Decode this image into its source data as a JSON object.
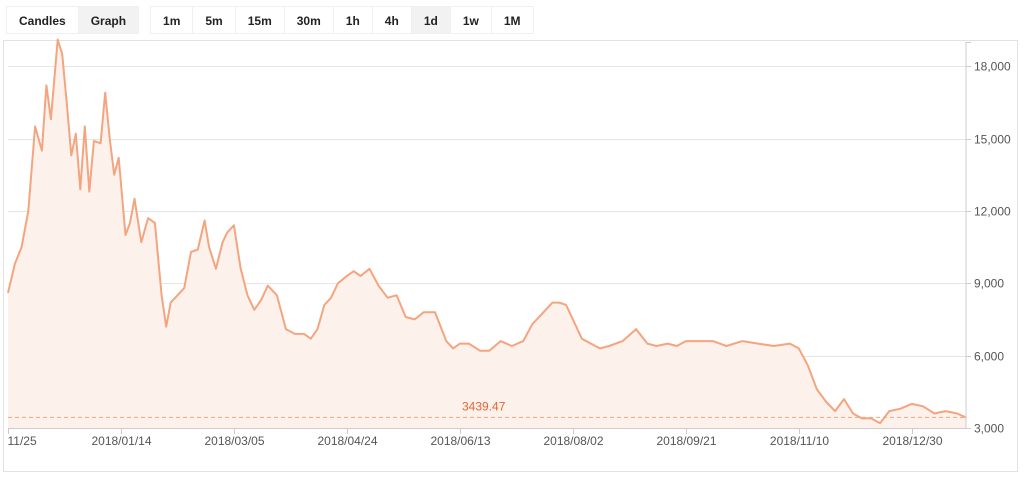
{
  "toolbar": {
    "chart_types": [
      "Candles",
      "Graph"
    ],
    "active_chart_type": "Graph",
    "intervals": [
      "1m",
      "5m",
      "15m",
      "30m",
      "1h",
      "4h",
      "1d",
      "1w",
      "1M"
    ],
    "active_interval": "1d"
  },
  "chart_data": {
    "type": "area",
    "title": "",
    "xlabel": "",
    "ylabel": "",
    "x_ticks": [
      "11/25",
      "2018/01/14",
      "2018/03/05",
      "2018/04/24",
      "2018/06/13",
      "2018/08/02",
      "2018/09/21",
      "2018/11/10",
      "2018/12/30"
    ],
    "y_ticks": [
      "3,000",
      "6,000",
      "9,000",
      "12,000",
      "15,000",
      "18,000"
    ],
    "ylim": [
      3000,
      19000
    ],
    "xlim": [
      "2017-11-25",
      "2019-01-23"
    ],
    "last_value_label": "3439.47",
    "last_value": 3439.47,
    "grid": true,
    "line_color": "#f4a57f",
    "fill_color": "#fdf1ec",
    "label_color": "#e8642f",
    "series": [
      {
        "x": [
          "2017-11-25",
          "2017-11-28",
          "2017-12-01",
          "2017-12-04",
          "2017-12-07",
          "2017-12-10",
          "2017-12-12",
          "2017-12-14",
          "2017-12-17",
          "2017-12-19",
          "2017-12-21",
          "2017-12-23",
          "2017-12-25",
          "2017-12-27",
          "2017-12-29",
          "2017-12-31",
          "2018-01-02",
          "2018-01-05",
          "2018-01-07",
          "2018-01-09",
          "2018-01-11",
          "2018-01-13",
          "2018-01-16",
          "2018-01-18",
          "2018-01-20",
          "2018-01-23",
          "2018-01-26",
          "2018-01-29",
          "2018-02-01",
          "2018-02-03",
          "2018-02-05",
          "2018-02-08",
          "2018-02-11",
          "2018-02-14",
          "2018-02-17",
          "2018-02-20",
          "2018-02-22",
          "2018-02-25",
          "2018-02-28",
          "2018-03-02",
          "2018-03-05",
          "2018-03-08",
          "2018-03-11",
          "2018-03-14",
          "2018-03-17",
          "2018-03-20",
          "2018-03-24",
          "2018-03-28",
          "2018-04-01",
          "2018-04-05",
          "2018-04-08",
          "2018-04-11",
          "2018-04-14",
          "2018-04-17",
          "2018-04-20",
          "2018-04-24",
          "2018-04-27",
          "2018-04-30",
          "2018-05-04",
          "2018-05-08",
          "2018-05-12",
          "2018-05-16",
          "2018-05-20",
          "2018-05-24",
          "2018-05-28",
          "2018-06-02",
          "2018-06-07",
          "2018-06-10",
          "2018-06-13",
          "2018-06-17",
          "2018-06-22",
          "2018-06-26",
          "2018-07-01",
          "2018-07-06",
          "2018-07-11",
          "2018-07-15",
          "2018-07-20",
          "2018-07-24",
          "2018-07-27",
          "2018-07-30",
          "2018-08-02",
          "2018-08-06",
          "2018-08-10",
          "2018-08-14",
          "2018-08-18",
          "2018-08-24",
          "2018-08-30",
          "2018-09-04",
          "2018-09-08",
          "2018-09-13",
          "2018-09-17",
          "2018-09-21",
          "2018-09-27",
          "2018-10-03",
          "2018-10-09",
          "2018-10-16",
          "2018-10-23",
          "2018-10-30",
          "2018-11-06",
          "2018-11-10",
          "2018-11-14",
          "2018-11-18",
          "2018-11-22",
          "2018-11-26",
          "2018-11-30",
          "2018-12-04",
          "2018-12-08",
          "2018-12-12",
          "2018-12-16",
          "2018-12-20",
          "2018-12-25",
          "2018-12-30",
          "2019-01-04",
          "2019-01-09",
          "2019-01-14",
          "2019-01-19",
          "2019-01-23"
        ],
        "y": [
          8600,
          9800,
          10500,
          12000,
          15500,
          14500,
          17200,
          15800,
          19100,
          18500,
          16500,
          14300,
          15200,
          12900,
          15500,
          12800,
          14900,
          14800,
          16900,
          15000,
          13500,
          14200,
          11000,
          11500,
          12500,
          10700,
          11700,
          11500,
          8500,
          7200,
          8200,
          8500,
          8800,
          10300,
          10400,
          11600,
          10500,
          9600,
          10700,
          11100,
          11400,
          9600,
          8500,
          7900,
          8300,
          8900,
          8500,
          7100,
          6900,
          6900,
          6700,
          7100,
          8100,
          8400,
          9000,
          9300,
          9500,
          9300,
          9600,
          8900,
          8400,
          8500,
          7600,
          7500,
          7800,
          7800,
          6600,
          6300,
          6500,
          6500,
          6200,
          6200,
          6600,
          6400,
          6600,
          7300,
          7800,
          8200,
          8200,
          8100,
          7500,
          6700,
          6500,
          6300,
          6400,
          6600,
          7100,
          6500,
          6400,
          6500,
          6400,
          6600,
          6600,
          6600,
          6400,
          6600,
          6500,
          6400,
          6500,
          6300,
          5600,
          4600,
          4100,
          3700,
          4200,
          3600,
          3400,
          3400,
          3200,
          3700,
          3800,
          4000,
          3900,
          3600,
          3700,
          3600,
          3439.47
        ]
      }
    ]
  }
}
